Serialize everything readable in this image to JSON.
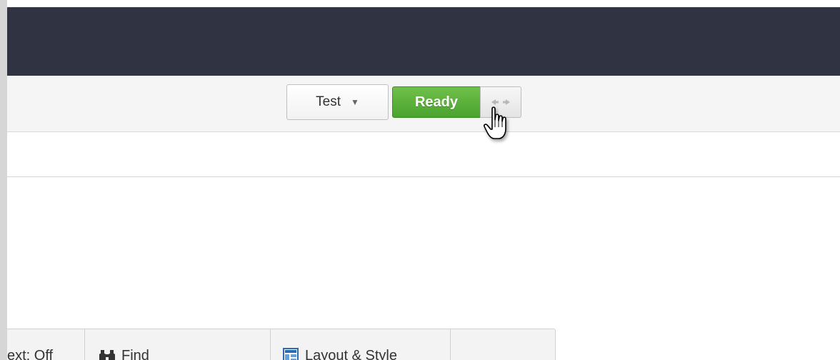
{
  "toolbar": {
    "mode_select": {
      "value": "Test"
    },
    "status_button": {
      "label": "Ready",
      "color": "#4fa832"
    },
    "swap_button": {
      "icon": "swap-arrows-icon"
    }
  },
  "bottom_toolbar": {
    "items": [
      {
        "label": "ext: Off"
      },
      {
        "label": "Find",
        "icon": "binoculars-icon"
      },
      {
        "label": "Layout & Style",
        "icon": "layout-icon"
      }
    ]
  },
  "colors": {
    "top_bar": "#2f3342",
    "toolbar_bg": "#f5f5f5",
    "accent_green": "#4fa832"
  }
}
